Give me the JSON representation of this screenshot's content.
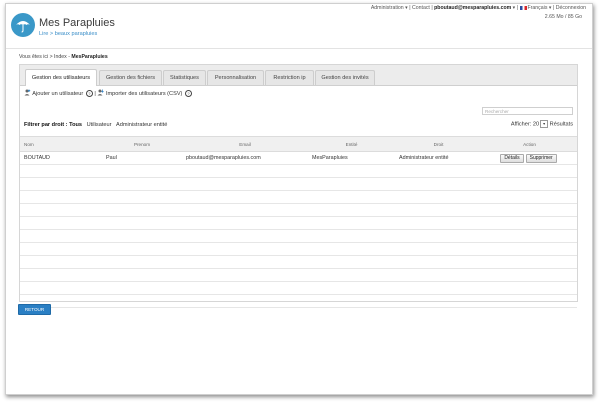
{
  "topbar": {
    "admin": "Administration",
    "contact": "Contact",
    "email": "pboutaud@mesparapluies.com",
    "language": "Français",
    "logout": "Déconnexion",
    "quota": "2.65 Mo / 85 Go"
  },
  "brand": {
    "title": "Mes Parapluies",
    "subtitle": "Lire > beaux parapluies",
    "color": "#3a98c8"
  },
  "breadcrumb": {
    "prefix": "Vous êtes ici",
    "parent": "Index",
    "current": "MesParapluies"
  },
  "tabs": [
    {
      "label": "Gestion des utilisateurs"
    },
    {
      "label": "Gestion des fichiers"
    },
    {
      "label": "Statistiques"
    },
    {
      "label": "Personnalisation"
    },
    {
      "label": "Restriction ip"
    },
    {
      "label": "Gestion des invités"
    }
  ],
  "actions": {
    "add_user": "Ajouter un utilisateur",
    "import_users": "Importer des utilisateurs (CSV)"
  },
  "search": {
    "placeholder": "Rechercher"
  },
  "filter": {
    "label": "Filtrer par droit :",
    "options": [
      "Tous",
      "Utilisateur",
      "Administrateur entité"
    ]
  },
  "perpage": {
    "label": "Afficher:",
    "value": "20",
    "suffix": "Résultats"
  },
  "table": {
    "columns": [
      "Nom",
      "Prenom",
      "Email",
      "Entité",
      "Droit",
      "Action"
    ],
    "rows": [
      {
        "nom": "BOUTAUD",
        "prenom": "Paul",
        "email": "pboutaud@mesparapluies.com",
        "entite": "MesParapluies",
        "droit": "Administrateur entité",
        "details": "Détails",
        "supprimer": "Supprimer"
      }
    ]
  },
  "retour": "RETOUR"
}
